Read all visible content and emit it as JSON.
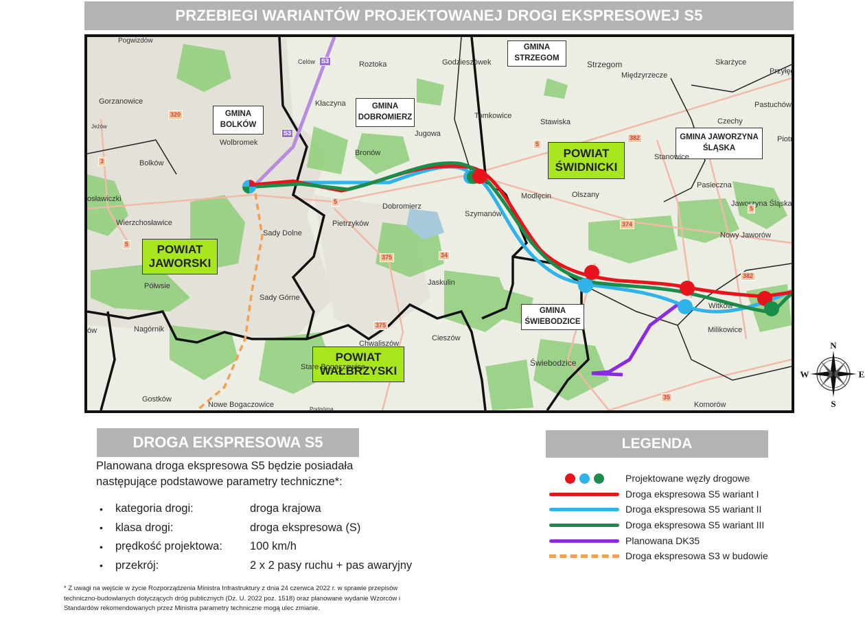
{
  "title": "PRZEBIEGI WARIANTÓW PROJEKTOWANEJ DROGI EKSPRESOWEJ S5",
  "colors": {
    "variant1": "#e8141b",
    "variant2": "#2fb3e8",
    "variant3": "#1c8c4a",
    "dk35": "#8a2be2",
    "s3": "#f3a057",
    "powiat_fill": "#a8e61d",
    "header_gray": "#b3b3b3"
  },
  "map": {
    "gminy": [
      {
        "name_line1": "GMINA",
        "name_line2": "BOLKÓW"
      },
      {
        "name_line1": "GMINA",
        "name_line2": "DOBROMIERZ"
      },
      {
        "name_line1": "GMINA",
        "name_line2": "STRZEGOM"
      },
      {
        "name_line1": "GMINA JAWORZYNA",
        "name_line2": "ŚLĄSKA"
      },
      {
        "name_line1": "GMINA",
        "name_line2": "ŚWIEBODZICE"
      }
    ],
    "powiaty": [
      {
        "line1": "POWIAT",
        "line2": "JAWORSKI"
      },
      {
        "line1": "POWIAT",
        "line2": "ŚWIDNICKI"
      },
      {
        "line1": "POWIAT",
        "line2": "WAŁBRZYSKI"
      }
    ],
    "places": [
      "Pogwizdów",
      "Celów",
      "Roztoka",
      "Godzieszówek",
      "Strzegom",
      "Międzyrzecze",
      "Skarżyce",
      "Przyłęg",
      "Gorzanowice",
      "Kłaczyna",
      "Pastuchów",
      "Jeżów",
      "Tomkowice",
      "Czechy",
      "Stawiska",
      "Jugowa",
      "Piotr",
      "Wolbromek",
      "Bolków",
      "Bronów",
      "Stanowice",
      "Pasieczna",
      "osławiczki",
      "Dobromierz",
      "Modlęcin",
      "Olszany",
      "Jaworzyna Śląska",
      "Szymanów",
      "Wierzchosławice",
      "Sady Dolne",
      "Pietrzyków",
      "Nowy Jaworów",
      "Jaskulin",
      "Półwsie",
      "Sady Górne",
      "Witków",
      "Nagórnik",
      "Milikowice",
      "Chwaliszów",
      "Cieszów",
      "ów",
      "Świebodzice",
      "Stare Bogaczowice",
      "Gostków",
      "Nowe Bogaczowice",
      "Komorów",
      "Podgórna"
    ],
    "road_signs": [
      "S3",
      "320",
      "S3",
      "3",
      "5",
      "5",
      "5",
      "382",
      "374",
      "375",
      "375",
      "34",
      "382",
      "35",
      "5"
    ]
  },
  "compass": {
    "n": "N",
    "s": "S",
    "e": "E",
    "w": "W"
  },
  "info": {
    "header": "DROGA EKSPRESOWA S5",
    "description": "Planowana droga ekspresowa S5 będzie posiadała następujące podstawowe parametry techniczne*:",
    "params": [
      {
        "label": "kategoria drogi:",
        "value": "droga krajowa"
      },
      {
        "label": "klasa drogi:",
        "value": "droga ekspresowa (S)"
      },
      {
        "label": "prędkość projektowa:",
        "value": "100 km/h"
      },
      {
        "label": "przekrój:",
        "value": "2 x 2 pasy ruchu + pas awaryjny"
      }
    ],
    "bullet": "•",
    "footnote": "* Z uwagi na wejście w życie Rozporządzenia Ministra Infrastruktury z dnia 24 czerwca 2022 r. w sprawie przepisów techniczno-budowlanych dotyczących dróg publicznych (Dz. U. 2022 poz. 1518) oraz planowane wydanie Wzorców i Standardów rekomendowanych przez Ministra parametry techniczne mogą ulec zmianie."
  },
  "legend": {
    "header": "LEGENDA",
    "items": [
      {
        "label": "Projektowane węzły drogowe",
        "symbol": "dots"
      },
      {
        "label": "Droga ekspresowa S5 wariant I",
        "symbol": "line-red"
      },
      {
        "label": "Droga ekspresowa S5 wariant II",
        "symbol": "line-blue"
      },
      {
        "label": "Droga ekspresowa S5 wariant III",
        "symbol": "line-green"
      },
      {
        "label": "Planowana DK35",
        "symbol": "line-purple"
      },
      {
        "label": "Droga ekspresowa S3 w budowie",
        "symbol": "dash-orange"
      }
    ]
  }
}
